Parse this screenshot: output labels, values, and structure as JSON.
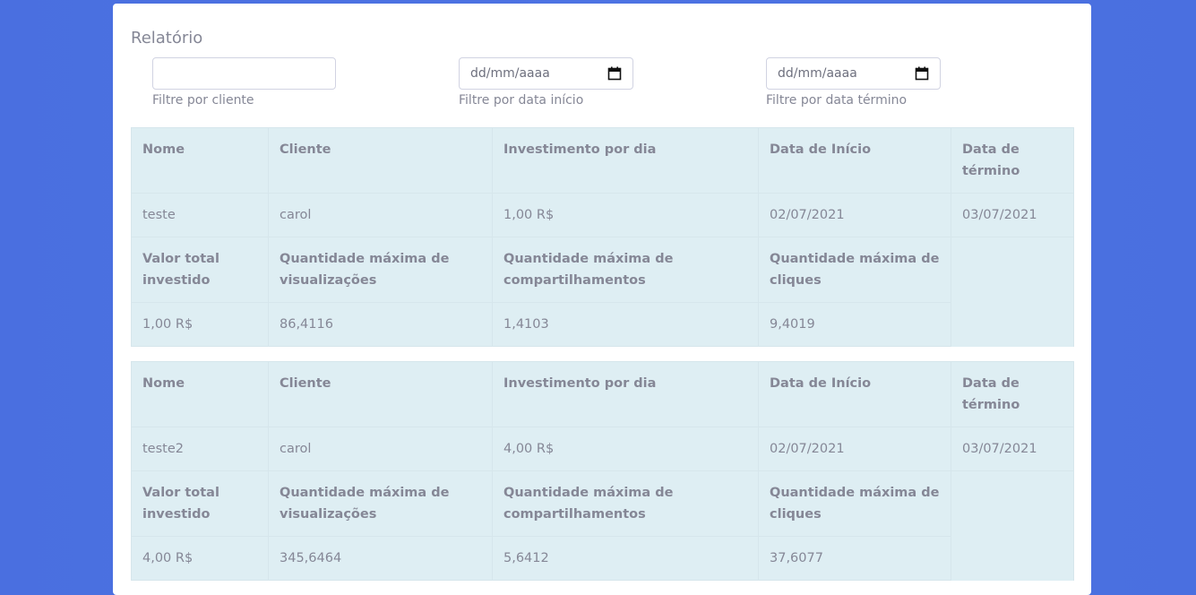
{
  "title": "Relatório",
  "filters": {
    "client": {
      "value": "",
      "help": "Filtre por cliente"
    },
    "start": {
      "placeholder": "dd/mm/aaaa",
      "help": "Filtre por data início"
    },
    "end": {
      "placeholder": "dd/mm/aaaa",
      "help": "Filtre por data término"
    }
  },
  "headers": {
    "nome": "Nome",
    "cliente": "Cliente",
    "investimento": "Investimento por dia",
    "inicio": "Data de Início",
    "termino": "Data de término",
    "valor_total": "Valor total investido",
    "max_visualizacoes": "Quantidade máxima de visualizações",
    "max_compartilhamentos": "Quantidade máxima de compartilhamentos",
    "max_cliques": "Quantidade máxima de cliques"
  },
  "reports": [
    {
      "nome": "teste",
      "cliente": "carol",
      "investimento": "1,00 R$",
      "inicio": "02/07/2021",
      "termino": "03/07/2021",
      "valor_total": "1,00 R$",
      "max_visualizacoes": "86,4116",
      "max_compartilhamentos": "1,4103",
      "max_cliques": "9,4019"
    },
    {
      "nome": "teste2",
      "cliente": "carol",
      "investimento": "4,00 R$",
      "inicio": "02/07/2021",
      "termino": "03/07/2021",
      "valor_total": "4,00 R$",
      "max_visualizacoes": "345,6464",
      "max_compartilhamentos": "5,6412",
      "max_cliques": "37,6077"
    }
  ]
}
